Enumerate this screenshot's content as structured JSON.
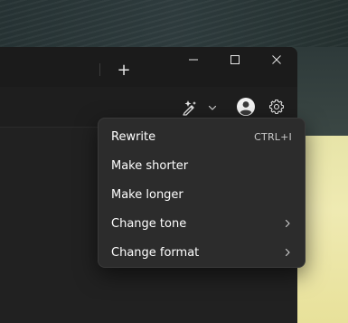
{
  "window": {
    "new_tab_glyph": "+",
    "minimize_glyph": "—",
    "close_glyph": "✕"
  },
  "toolbar": {
    "copilot_icon": "sparkle-pen-icon",
    "dropdown_icon": "chevron-down-icon",
    "account_icon": "person-icon",
    "settings_icon": "gear-icon"
  },
  "menu": {
    "items": [
      {
        "label": "Rewrite",
        "accelerator": "CTRL+I",
        "submenu": false
      },
      {
        "label": "Make shorter",
        "accelerator": "",
        "submenu": false
      },
      {
        "label": "Make longer",
        "accelerator": "",
        "submenu": false
      },
      {
        "label": "Change tone",
        "accelerator": "",
        "submenu": true
      },
      {
        "label": "Change format",
        "accelerator": "",
        "submenu": true
      }
    ]
  },
  "colors": {
    "window_bg": "#202020",
    "menu_bg": "#2c2c2c",
    "text": "#ffffff"
  }
}
